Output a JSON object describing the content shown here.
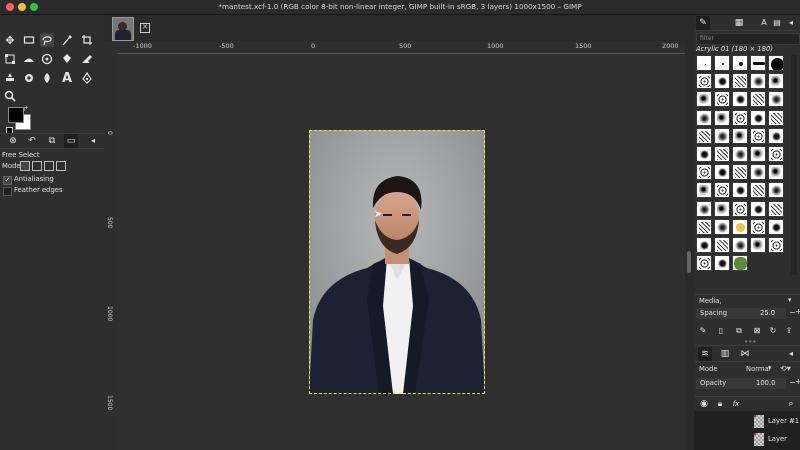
{
  "window": {
    "title": "*mantest.xcf-1.0 (RGB color 8-bit non-linear integer, GIMP built-in sRGB, 3 layers) 1000x1500 – GIMP",
    "colors": {
      "close": "#ff5f57",
      "minimize": "#febc2e",
      "zoom": "#28c840"
    }
  },
  "toolbox": {
    "tools": [
      "move-tool",
      "rect-select-tool",
      "free-select-tool",
      "fuzzy-select-tool",
      "crop-tool",
      "unified-transform-tool",
      "warp-tool",
      "cage-tool",
      "bucket-fill-tool",
      "eraser-tool",
      "clone-tool",
      "smudge-tool",
      "dodge-tool",
      "text-tool",
      "path-tool",
      "zoom-tool"
    ],
    "options_title": "Free Select",
    "mode_label": "Mode:",
    "antialiasing_label": "Antialiasing",
    "antialiasing_checked": true,
    "feather_label": "Feather edges",
    "feather_checked": false
  },
  "ruler": {
    "top_labels": [
      "-1000",
      "-500",
      "0",
      "500",
      "1000",
      "1500",
      "2000"
    ],
    "left_labels": [
      "0",
      "500",
      "1000",
      "1500"
    ]
  },
  "dock": {
    "filter_placeholder": "filter",
    "brush_name": "Acrylic 01 (180 × 180)",
    "brush_preset": "Media,",
    "spacing_label": "Spacing",
    "spacing_value": "25.0",
    "mode_label": "Mode",
    "mode_value": "Normal",
    "opacity_label": "Opacity",
    "opacity_value": "100.0",
    "layers": [
      {
        "name": "Layer #1"
      },
      {
        "name": "Layer"
      }
    ]
  }
}
